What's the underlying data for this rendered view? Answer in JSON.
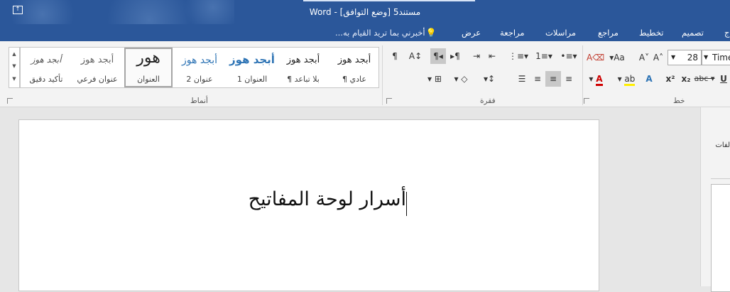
{
  "titlebar": {
    "title": "مستند5 [وضع التوافق] - Word"
  },
  "tabs": [
    "ج",
    "تصميم",
    "تخطيط",
    "مراجع",
    "مراسلات",
    "مراجعة",
    "عرض"
  ],
  "tellme": {
    "placeholder": "أخبرني بما تريد القيام به..."
  },
  "groups": {
    "styles": "أنماط",
    "paragraph": "فقرة",
    "font": "خط"
  },
  "styles": [
    {
      "sample": "أبجد هوز",
      "name": "¶ عادي"
    },
    {
      "sample": "أبجد هوز",
      "name": "¶ بلا تباعد"
    },
    {
      "sample": "أبجد هوز",
      "name": "العنوان 1"
    },
    {
      "sample": "أبجد هوز",
      "name": "عنوان 2"
    },
    {
      "sample": "هور",
      "name": "العنوان"
    },
    {
      "sample": "أبجد هوز",
      "name": "عنوان فرعي"
    },
    {
      "sample": "أبجد هوز",
      "name": "تأكيد دقيق"
    }
  ],
  "font": {
    "size": "28",
    "name": "Time"
  },
  "document": {
    "text": "أسرار لوحة المفاتيح"
  },
  "panel": {
    "label": "لفات"
  },
  "colors": {
    "accent": "#2b579a",
    "font_color": "#d00000",
    "highlight": "#ffee00",
    "heading_blue": "#2e74b5"
  }
}
